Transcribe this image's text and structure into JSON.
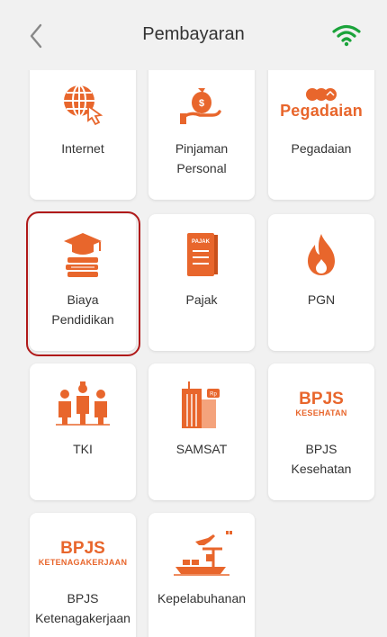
{
  "header": {
    "title": "Pembayaran",
    "back_icon": "chevron-left-icon",
    "wifi_icon": "wifi-icon",
    "accent_color": "#e8662c",
    "wifi_color": "#1aa33a"
  },
  "tiles": [
    {
      "label": "Internet",
      "icon": "globe-cursor-icon"
    },
    {
      "label": "Pinjaman\nPersonal",
      "icon": "hand-money-bag-icon"
    },
    {
      "label": "Pegadaian",
      "icon": "pegadaian-logo-icon",
      "logo_text": "Pegadaian"
    },
    {
      "label": "Biaya\nPendidikan",
      "icon": "graduation-books-icon"
    },
    {
      "label": "Pajak",
      "icon": "tax-book-icon",
      "icon_text": "PAJAK"
    },
    {
      "label": "PGN",
      "icon": "flame-icon"
    },
    {
      "label": "TKI",
      "icon": "workers-icon"
    },
    {
      "label": "SAMSAT",
      "icon": "building-icon"
    },
    {
      "label": "BPJS\nKesehatan",
      "icon": "bpjs-kesehatan-logo",
      "logo_main": "BPJS",
      "logo_sub": "KESEHATAN"
    },
    {
      "label": "BPJS\nKetenagakerjaan",
      "icon": "bpjs-ketenagakerjaan-logo",
      "logo_main": "BPJS",
      "logo_sub": "KETENAGAKERJAAN"
    },
    {
      "label": "Kepelabuhanan",
      "icon": "ship-plane-icon"
    }
  ]
}
